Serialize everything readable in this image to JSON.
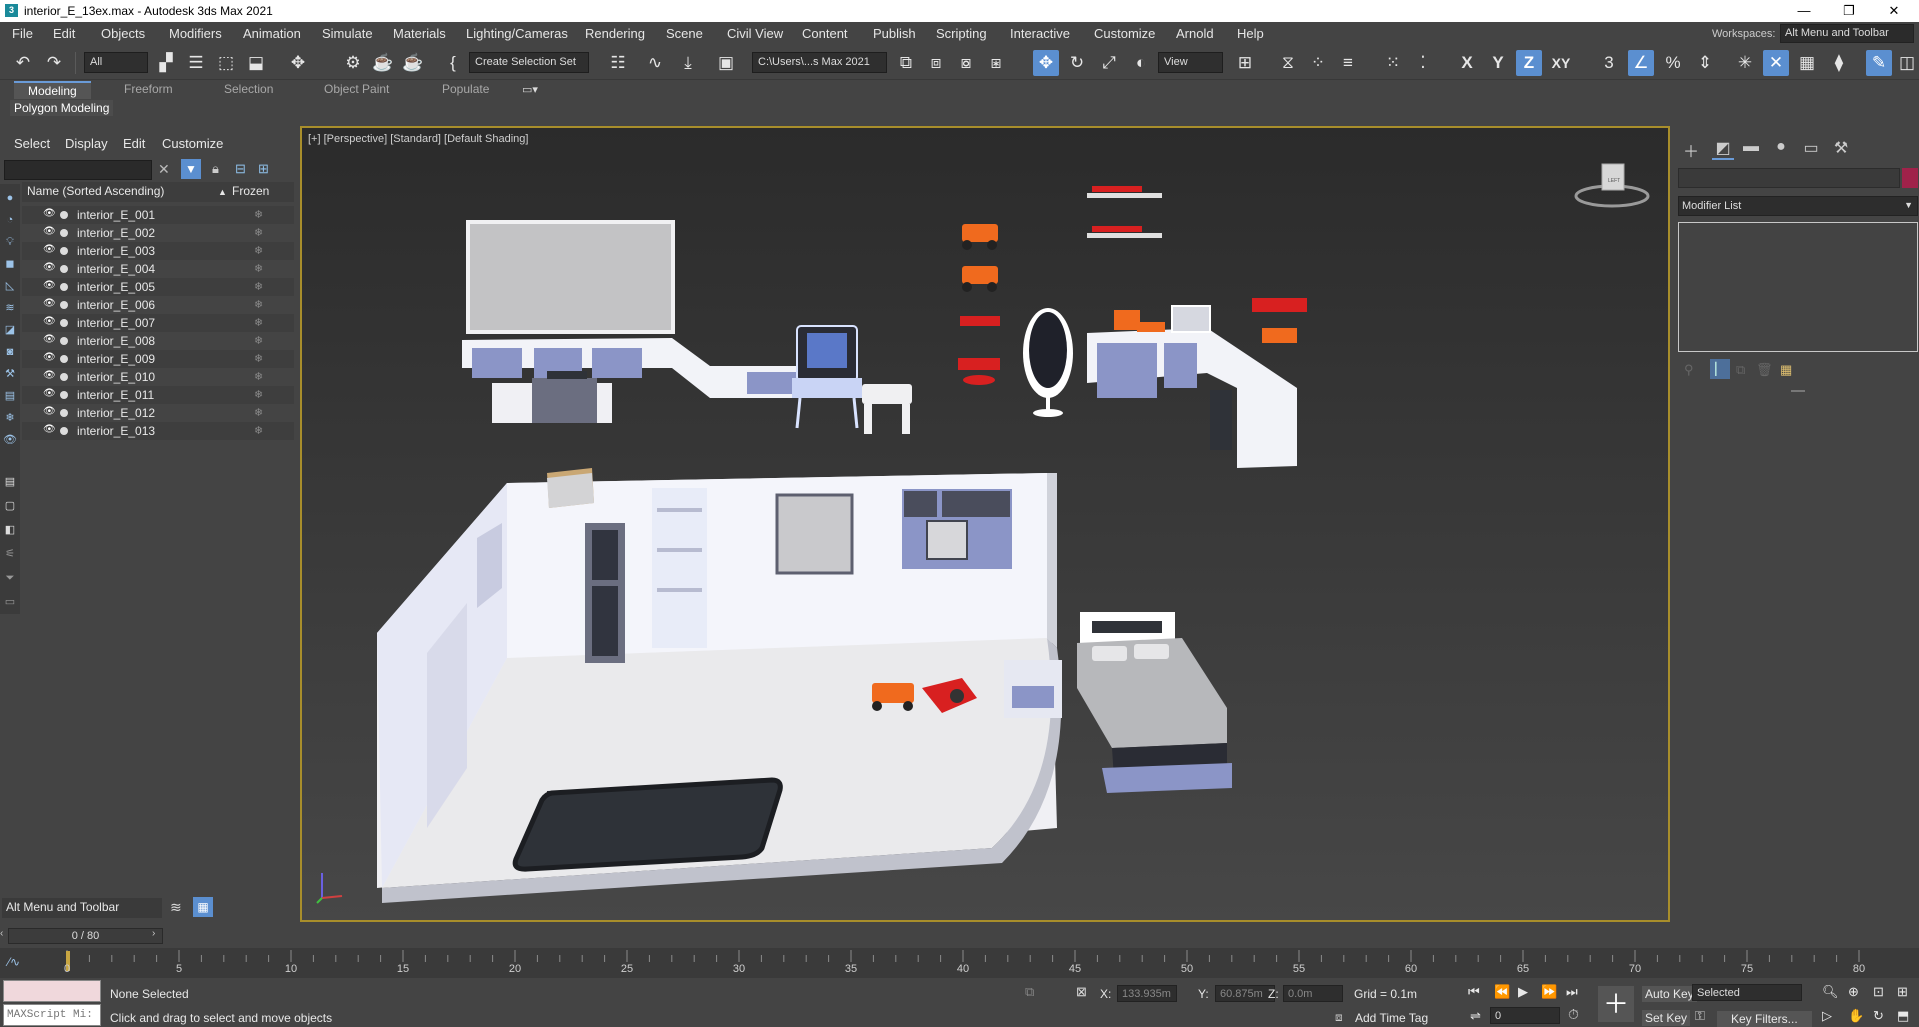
{
  "window": {
    "title": "interior_E_13ex.max - Autodesk 3ds Max 2021",
    "app_icon": "3"
  },
  "menubar": {
    "items": [
      "File",
      "Edit",
      "Objects",
      "Modifiers",
      "Animation",
      "Simulate",
      "Materials",
      "Lighting/Cameras",
      "Rendering",
      "Scene",
      "Civil View",
      "Content",
      "Publish",
      "Scripting",
      "Interactive",
      "Customize",
      "Arnold",
      "Help"
    ],
    "workspaces_label": "Workspaces:",
    "workspace_value": "Alt Menu and Toolbar"
  },
  "toolbar": {
    "filter_value": "All",
    "selection_set_placeholder": "Create Selection Set",
    "path_value": "C:\\Users\\...s Max 2021",
    "ref_coord_value": "View",
    "axis_x": "X",
    "axis_y": "Y",
    "axis_z": "Z",
    "axis_xy": "XY",
    "snap_label": "3",
    "percent_label": "%"
  },
  "ribbon": {
    "tabs": [
      "Modeling",
      "Freeform",
      "Selection",
      "Object Paint",
      "Populate"
    ],
    "active_tab": "Modeling",
    "sub_tab": "Polygon Modeling"
  },
  "scene_explorer": {
    "menu": [
      "Select",
      "Display",
      "Edit",
      "Customize"
    ],
    "column_name": "Name (Sorted Ascending)",
    "column_frozen": "Frozen",
    "sort_arrow": "▲",
    "objects": [
      "interior_E_001",
      "interior_E_002",
      "interior_E_003",
      "interior_E_004",
      "interior_E_005",
      "interior_E_006",
      "interior_E_007",
      "interior_E_008",
      "interior_E_009",
      "interior_E_010",
      "interior_E_011",
      "interior_E_012",
      "interior_E_013"
    ]
  },
  "viewport": {
    "label": "[+] [Perspective] [Standard] [Default Shading]",
    "viewcube_label": "LEFT"
  },
  "command_panel": {
    "modifier_list": "Modifier List",
    "accent_color": "#a0224a"
  },
  "workspace_bottom": {
    "value": "Alt Menu and Toolbar"
  },
  "timeline": {
    "frame_display": "0 / 80",
    "ticks": [
      "0",
      "5",
      "10",
      "15",
      "20",
      "25",
      "30",
      "35",
      "40",
      "45",
      "50",
      "55",
      "60",
      "65",
      "70",
      "75",
      "80"
    ],
    "current_frame": 0,
    "total_frames": 80
  },
  "status": {
    "maxscript_placeholder": "MAXScript Mi:",
    "selection": "None Selected",
    "prompt": "Click and drag to select and move objects",
    "x_label": "X:",
    "x_value": "133.935m",
    "y_label": "Y:",
    "y_value": "60.875m",
    "z_label": "Z:",
    "z_value": "0.0m",
    "grid": "Grid = 0.1m",
    "add_time_tag": "Add Time Tag",
    "auto_key": "Auto Key",
    "set_key": "Set Key",
    "key_mode_value": "Selected",
    "frame_value": "0",
    "key_filters": "Key Filters..."
  }
}
